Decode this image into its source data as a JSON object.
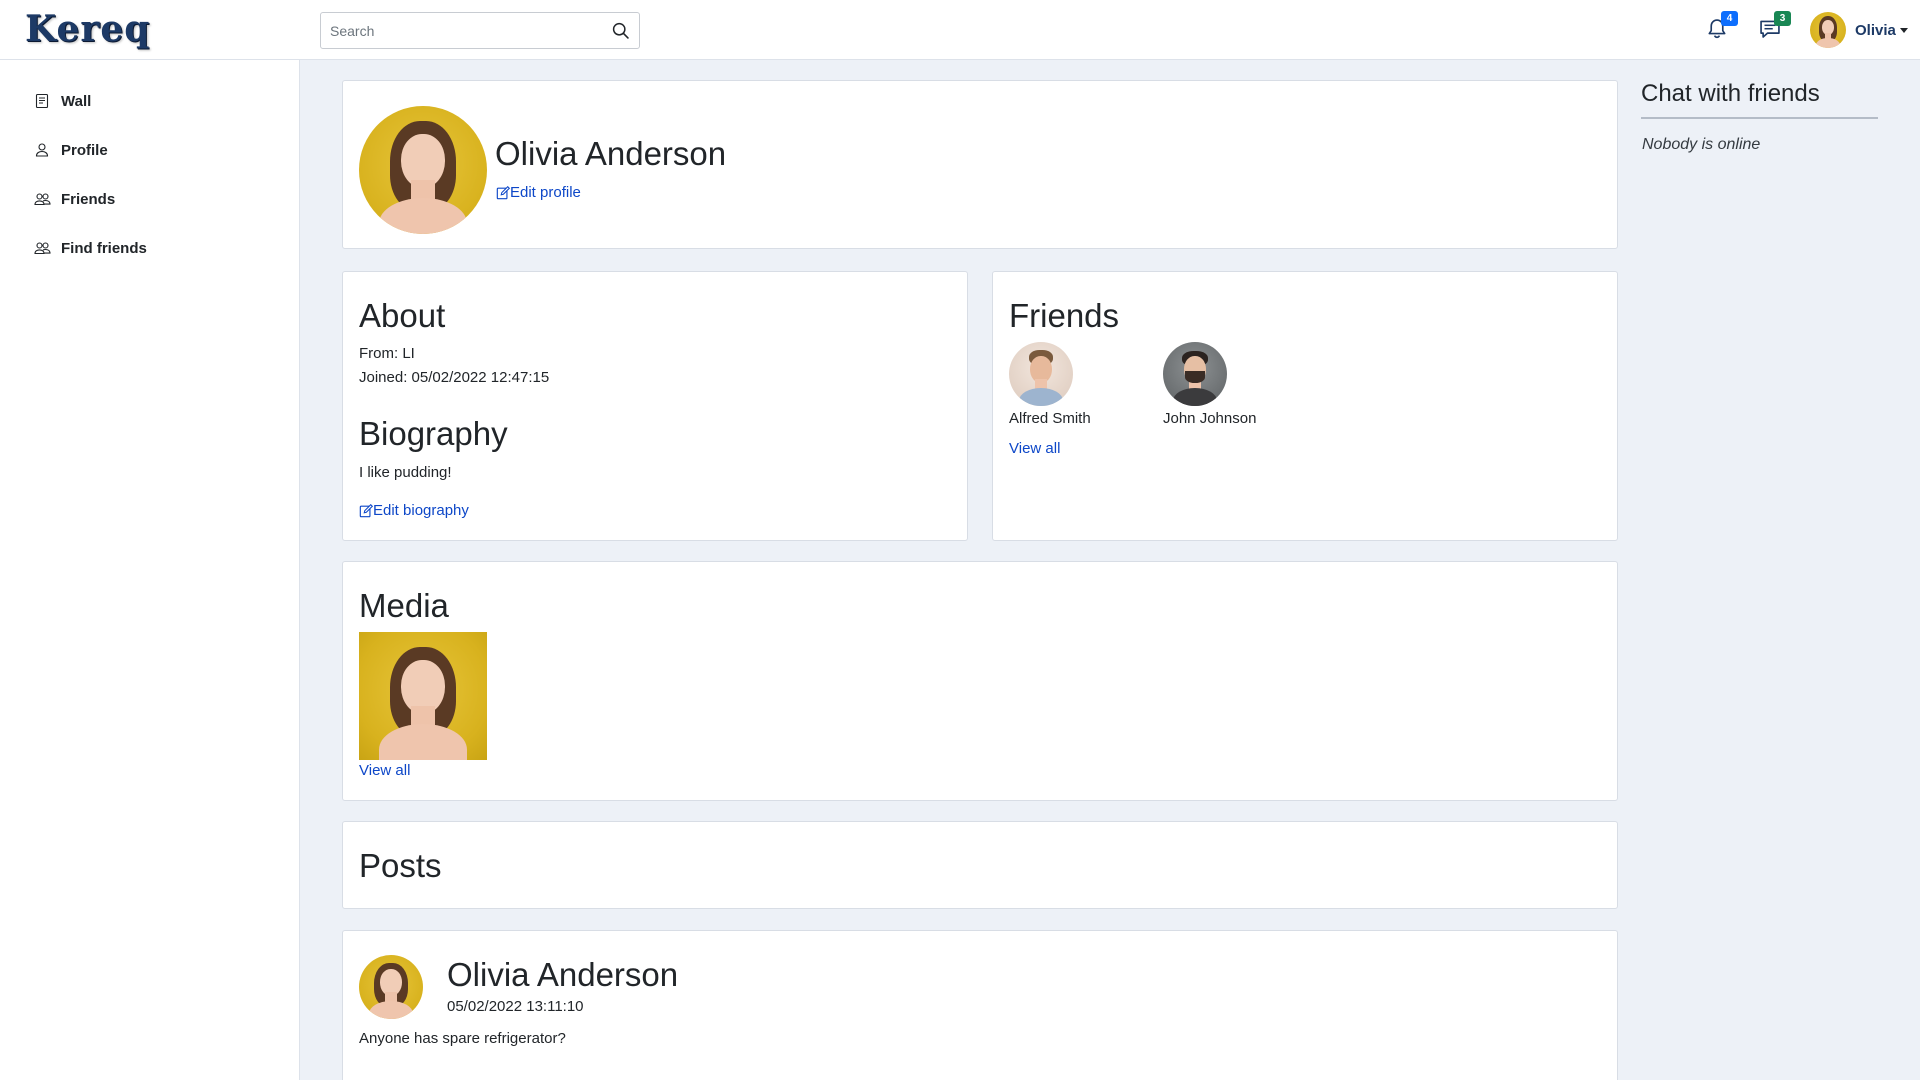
{
  "brand": {
    "logo_text": "Kereq"
  },
  "header": {
    "search_placeholder": "Search",
    "notifications_count": "4",
    "messages_count": "3",
    "user_name": "Olivia"
  },
  "sidebar": {
    "items": [
      {
        "label": "Wall",
        "icon": "wall-icon"
      },
      {
        "label": "Profile",
        "icon": "person-icon"
      },
      {
        "label": "Friends",
        "icon": "people-icon"
      },
      {
        "label": "Find friends",
        "icon": "people-icon"
      }
    ]
  },
  "profile": {
    "name": "Olivia Anderson",
    "edit_label": "Edit profile"
  },
  "about": {
    "title": "About",
    "from": "From: LI",
    "joined": "Joined: 05/02/2022 12:47:15"
  },
  "biography": {
    "title": "Biography",
    "text": "I like pudding!",
    "edit_label": "Edit biography"
  },
  "friends": {
    "title": "Friends",
    "items": [
      {
        "name": "Alfred Smith"
      },
      {
        "name": "John Johnson"
      }
    ],
    "view_all": "View all"
  },
  "media": {
    "title": "Media",
    "view_all": "View all"
  },
  "posts": {
    "title": "Posts",
    "items": [
      {
        "author": "Olivia Anderson",
        "timestamp": "05/02/2022 13:11:10",
        "text": "Anyone has spare refrigerator?"
      }
    ]
  },
  "chat": {
    "title": "Chat with friends",
    "status": "Nobody is online"
  },
  "colors": {
    "link": "#0d47c8",
    "page_background": "#edf1f7",
    "badge_notifications": "#0d6efd",
    "badge_messages": "#198754",
    "logo": "#1d3a66"
  }
}
